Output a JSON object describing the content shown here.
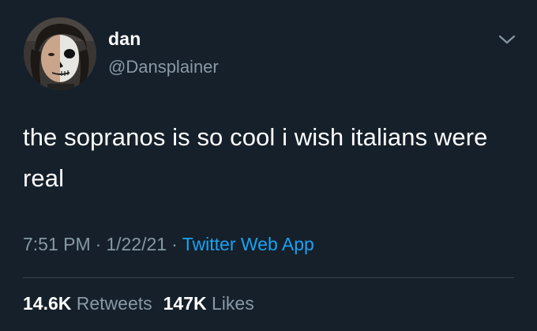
{
  "author": {
    "display_name": "dan",
    "handle": "@Dansplainer",
    "avatar": "avatar-photo-face-paint"
  },
  "menu": {
    "icon": "chevron-down-icon"
  },
  "tweet": {
    "text": "the sopranos is so cool i wish italians were real"
  },
  "meta": {
    "time": "7:51 PM",
    "separator": "·",
    "date": "1/22/21",
    "source": "Twitter Web App"
  },
  "stats": {
    "retweets_count": "14.6K",
    "retweets_label": "Retweets",
    "likes_count": "147K",
    "likes_label": "Likes"
  },
  "colors": {
    "background": "#15202b",
    "primary_text": "#ffffff",
    "secondary_text": "#8899a6",
    "link": "#1da1f2",
    "divider": "#38444d"
  }
}
